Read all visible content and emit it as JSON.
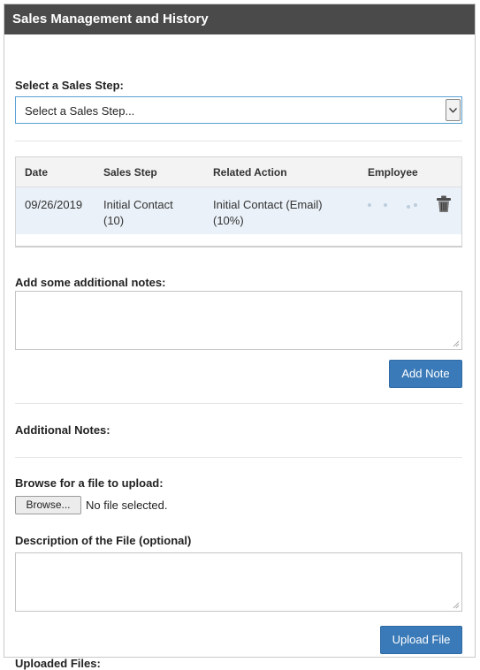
{
  "panel": {
    "title": "Sales Management and History"
  },
  "sales_step": {
    "label": "Select a Sales Step:",
    "selected": "Select a Sales Step..."
  },
  "history_table": {
    "columns": [
      "Date",
      "Sales Step",
      "Related Action",
      "Employee"
    ],
    "rows": [
      {
        "date": "09/26/2019",
        "sales_step_line1": "Initial Contact",
        "sales_step_line2": "(10)",
        "action_line1": "Initial Contact (Email)",
        "action_line2": "(10%)"
      }
    ]
  },
  "notes": {
    "label": "Add some additional notes:",
    "value": "",
    "add_button": "Add Note"
  },
  "additional_notes": {
    "label": "Additional Notes:"
  },
  "upload": {
    "label": "Browse for a file to upload:",
    "browse_button": "Browse...",
    "status": "No file selected.",
    "description_label": "Description of the File (optional)",
    "description_value": "",
    "upload_button": "Upload File"
  },
  "uploaded_files": {
    "label": "Uploaded Files:"
  },
  "icons": {
    "dropdown": "chevron-down-icon",
    "delete": "trash-icon",
    "resize": "resize-grip-icon"
  },
  "colors": {
    "header_bg": "#4a4a4a",
    "button_bg": "#3a7ab8",
    "row_highlight": "#eaf1f8",
    "select_focus_border": "#5aa0d3"
  }
}
